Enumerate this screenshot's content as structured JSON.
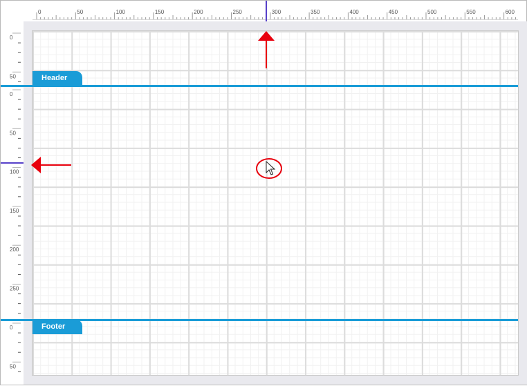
{
  "ruler_top": {
    "labels": [
      "0",
      "50",
      "100",
      "150",
      "200",
      "250",
      "300",
      "350",
      "400",
      "450",
      "500",
      "550",
      "600"
    ]
  },
  "ruler_left": {
    "header_labels": [
      "0",
      "50"
    ],
    "detail_labels": [
      "0",
      "50",
      "100",
      "150",
      "200",
      "250"
    ],
    "footer_labels": [
      "0",
      "50"
    ]
  },
  "bands": {
    "header": {
      "label": "Header"
    },
    "footer": {
      "label": "Footer"
    }
  },
  "colors": {
    "band": "#1a9cd7",
    "cursor_guide": "#5640c9",
    "annotation": "#e8000d"
  },
  "icons": {
    "cursor": "mouse-pointer-icon"
  }
}
